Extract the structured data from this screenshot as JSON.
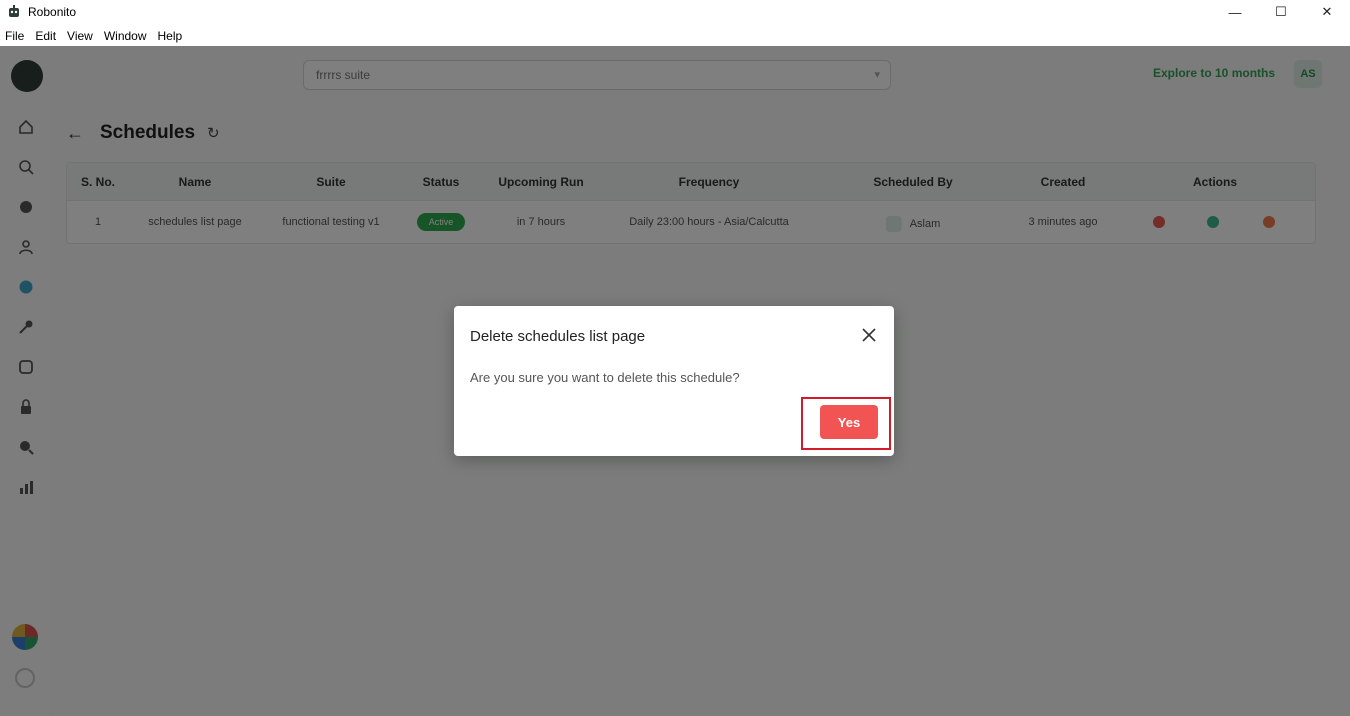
{
  "window": {
    "title": "Robonito",
    "controls": {
      "minimize": "—",
      "maximize": "☐",
      "close": "✕"
    }
  },
  "menu": [
    "File",
    "Edit",
    "View",
    "Window",
    "Help"
  ],
  "header": {
    "search_value": "frrrrs suite",
    "explore_label": "Explore to 10 months",
    "user_initials": "AS"
  },
  "page": {
    "title": "Schedules",
    "back_icon": "arrow-left-icon",
    "refresh_icon": "refresh-icon"
  },
  "table": {
    "columns": [
      "S. No.",
      "Name",
      "Suite",
      "Status",
      "Upcoming Run",
      "Frequency",
      "Scheduled By",
      "Created",
      "Actions"
    ],
    "rows": [
      {
        "sno": "1",
        "name": "schedules list page",
        "suite": "functional testing v1",
        "status": "Active",
        "upcoming": "in 7 hours",
        "frequency": "Daily 23:00 hours - Asia/Calcutta",
        "scheduled_by": "Aslam",
        "created": "3 minutes ago"
      }
    ]
  },
  "modal": {
    "title": "Delete schedules list page",
    "message": "Are you sure you want to delete this schedule?",
    "confirm_label": "Yes",
    "confirm_color": "#f25454",
    "highlight_color": "#d11a2a"
  }
}
